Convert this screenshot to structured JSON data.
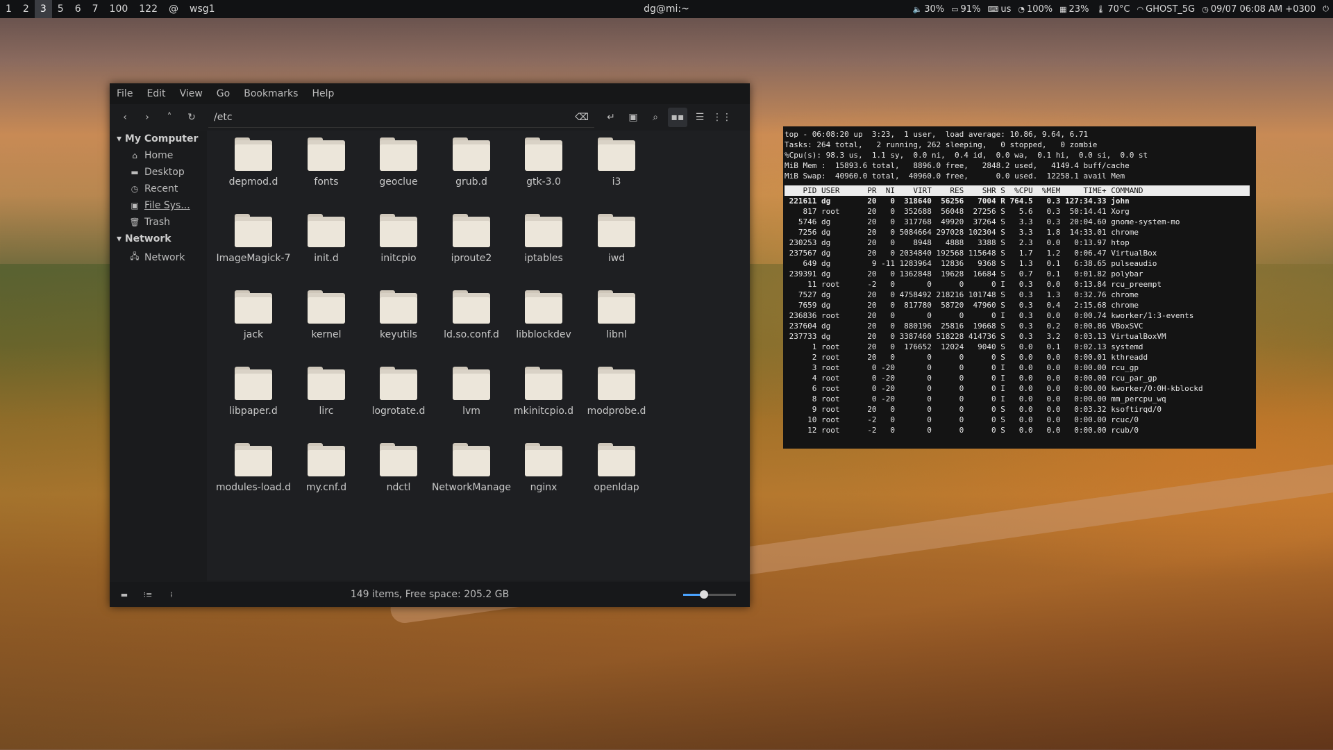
{
  "topbar": {
    "workspaces": [
      "1",
      "2",
      "3",
      "5",
      "6",
      "7",
      "100",
      "122",
      "@",
      "wsg1"
    ],
    "active_workspace": "3",
    "title": "dg@mi:~",
    "status": {
      "volume": "30%",
      "battery": "91%",
      "keyboard": "us",
      "brightness": "100%",
      "memory": "23%",
      "temp": "70°C",
      "wifi": "GHOST_5G",
      "datetime": "09/07 06:08 AM +0300"
    }
  },
  "file_manager": {
    "menu": [
      "File",
      "Edit",
      "View",
      "Go",
      "Bookmarks",
      "Help"
    ],
    "path": "/etc",
    "sidebar": {
      "my_computer": "My Computer",
      "computer_items": [
        "Home",
        "Desktop",
        "Recent",
        "File Sys...",
        "Trash"
      ],
      "network_header": "Network",
      "network_items": [
        "Network"
      ]
    },
    "folders": [
      "depmod.d",
      "fonts",
      "geoclue",
      "grub.d",
      "gtk-3.0",
      "i3",
      "ImageMagick-7",
      "init.d",
      "initcpio",
      "iproute2",
      "iptables",
      "iwd",
      "jack",
      "kernel",
      "keyutils",
      "ld.so.conf.d",
      "libblockdev",
      "libnl",
      "libpaper.d",
      "lirc",
      "logrotate.d",
      "lvm",
      "mkinitcpio.d",
      "modprobe.d",
      "modules-load.d",
      "my.cnf.d",
      "ndctl",
      "NetworkManage",
      "nginx",
      "openldap"
    ],
    "status_text": "149 items, Free space: 205.2 GB",
    "zoom_level": 0.4
  },
  "terminal": {
    "summary": [
      "top - 06:08:20 up  3:23,  1 user,  load average: 10.86, 9.64, 6.71",
      "Tasks: 264 total,   2 running, 262 sleeping,   0 stopped,   0 zombie",
      "%Cpu(s): 98.3 us,  1.1 sy,  0.0 ni,  0.4 id,  0.0 wa,  0.1 hi,  0.0 si,  0.0 st",
      "MiB Mem :  15893.6 total,   8896.0 free,   2848.2 used,   4149.4 buff/cache",
      "MiB Swap:  40960.0 total,  40960.0 free,      0.0 used.  12258.1 avail Mem"
    ],
    "header": "    PID USER      PR  NI    VIRT    RES    SHR S  %CPU  %MEM     TIME+ COMMAND",
    "rows": [
      " 221611 dg        20   0  318640  56256   7004 R 764.5   0.3 127:34.33 john",
      "    817 root      20   0  352688  56048  27256 S   5.6   0.3  50:14.41 Xorg",
      "   5746 dg        20   0  317768  49920  37264 S   3.3   0.3  20:04.60 gnome-system-mo",
      "   7256 dg        20   0 5084664 297028 102304 S   3.3   1.8  14:33.01 chrome",
      " 230253 dg        20   0    8948   4888   3388 S   2.3   0.0   0:13.97 htop",
      " 237567 dg        20   0 2034840 192568 115648 S   1.7   1.2   0:06.47 VirtualBox",
      "    649 dg         9 -11 1283964  12836   9368 S   1.3   0.1   6:38.65 pulseaudio",
      " 239391 dg        20   0 1362848  19628  16684 S   0.7   0.1   0:01.82 polybar",
      "     11 root      -2   0       0      0      0 I   0.3   0.0   0:13.84 rcu_preempt",
      "   7527 dg        20   0 4758492 218216 101748 S   0.3   1.3   0:32.76 chrome",
      "   7659 dg        20   0  817780  58720  47960 S   0.3   0.4   2:15.68 chrome",
      " 236836 root      20   0       0      0      0 I   0.3   0.0   0:00.74 kworker/1:3-events",
      " 237604 dg        20   0  880196  25816  19668 S   0.3   0.2   0:00.86 VBoxSVC",
      " 237733 dg        20   0 3387460 518228 414736 S   0.3   3.2   0:03.13 VirtualBoxVM",
      "      1 root      20   0  176652  12024   9040 S   0.0   0.1   0:02.13 systemd",
      "      2 root      20   0       0      0      0 S   0.0   0.0   0:00.01 kthreadd",
      "      3 root       0 -20       0      0      0 I   0.0   0.0   0:00.00 rcu_gp",
      "      4 root       0 -20       0      0      0 I   0.0   0.0   0:00.00 rcu_par_gp",
      "      6 root       0 -20       0      0      0 I   0.0   0.0   0:00.00 kworker/0:0H-kblockd",
      "      8 root       0 -20       0      0      0 I   0.0   0.0   0:00.00 mm_percpu_wq",
      "      9 root      20   0       0      0      0 S   0.0   0.0   0:03.32 ksoftirqd/0",
      "     10 root      -2   0       0      0      0 S   0.0   0.0   0:00.00 rcuc/0",
      "     12 root      -2   0       0      0      0 S   0.0   0.0   0:00.00 rcub/0"
    ]
  }
}
